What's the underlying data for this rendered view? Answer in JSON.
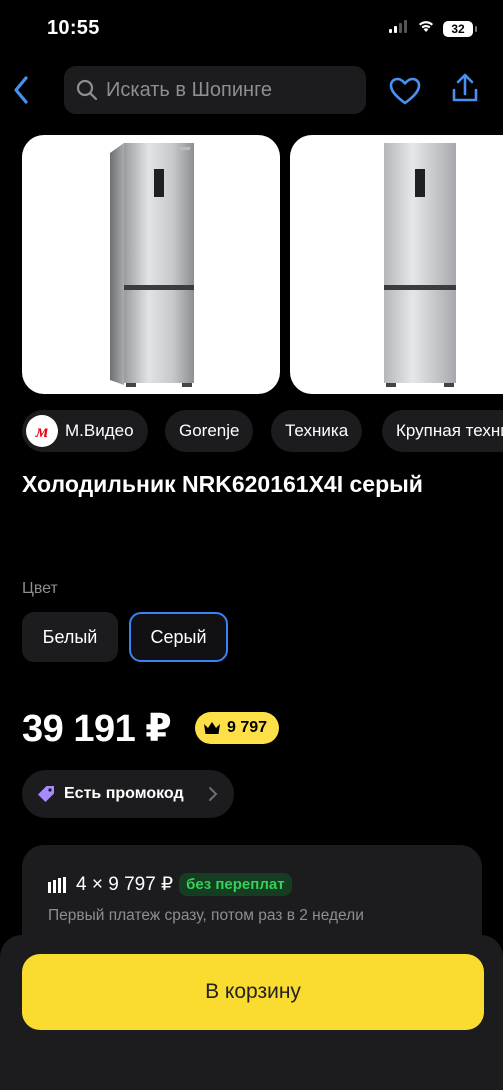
{
  "status_bar": {
    "time": "10:55",
    "battery": "32"
  },
  "search": {
    "placeholder": "Искать в Шопинге"
  },
  "chips": [
    {
      "label": "М.Видео",
      "logo_letter": "м"
    },
    {
      "label": "Gorenje"
    },
    {
      "label": "Техника"
    },
    {
      "label": "Крупная техника"
    }
  ],
  "product": {
    "title": "Холодильник NRK620161X4I серый",
    "color_label": "Цвет",
    "colors": [
      {
        "label": "Белый",
        "selected": false
      },
      {
        "label": "Серый",
        "selected": true
      }
    ],
    "price": "39 191 ₽",
    "bonus": "9 797",
    "promo_label": "Есть промокод"
  },
  "split": {
    "amount": "4 × 9 797 ₽",
    "badge": "без переплат",
    "note": "Первый платеж сразу, потом раз в 2 недели"
  },
  "cart": {
    "button_label": "В корзину"
  },
  "colors": {
    "accent_blue": "#3b82f6",
    "brand_yellow": "#f9dc2f",
    "green_badge": "#34d058",
    "mvideo_red": "#e30613"
  }
}
